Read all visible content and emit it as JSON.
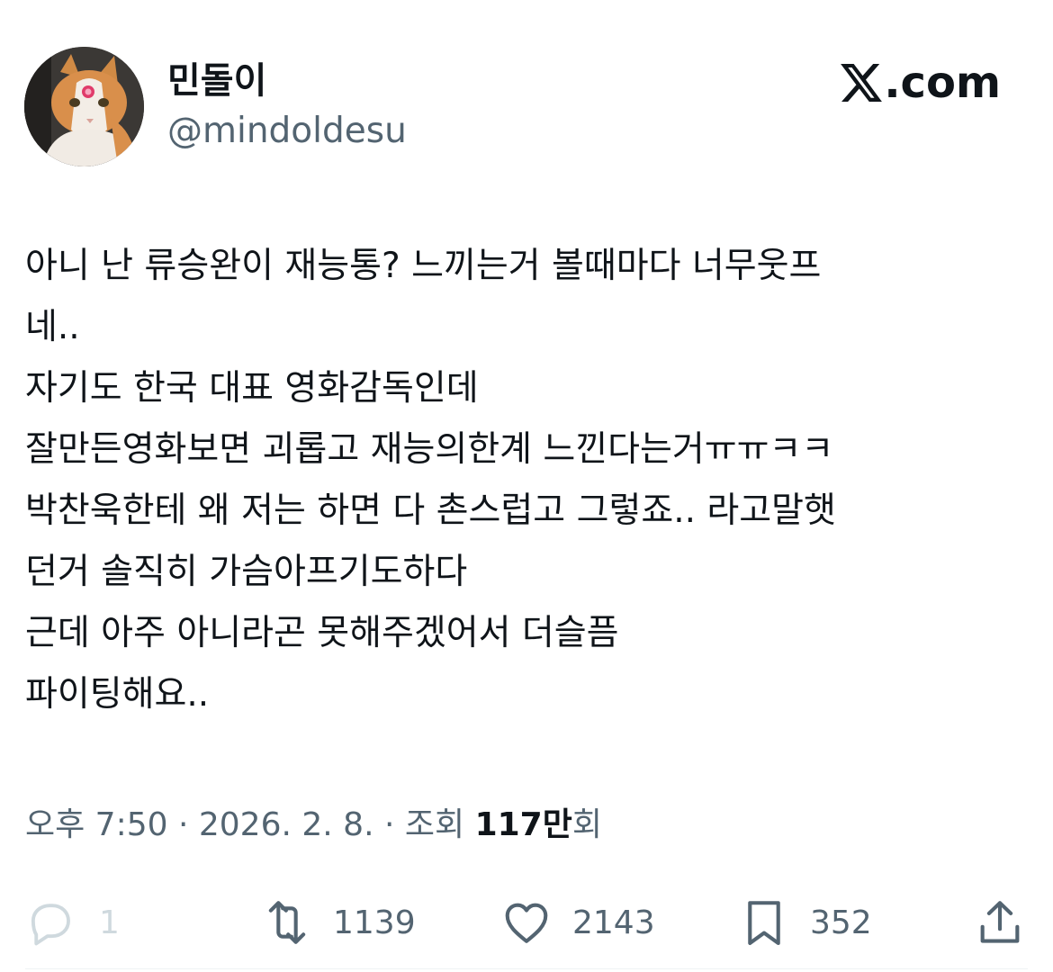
{
  "author": {
    "display_name": "민돌이",
    "handle": "@mindoldesu"
  },
  "brand": {
    "logo_icon": "x-logo-icon",
    "label": ".com"
  },
  "tweet": {
    "lines": [
      "아니 난 류승완이 재능통? 느끼는거 볼때마다 너무웃프",
      "네..",
      "자기도 한국 대표 영화감독인데",
      "잘만든영화보면 괴롭고 재능의한계 느낀다는거ㅠㅠㅋㅋ",
      "박찬욱한테 왜 저는 하면 다 촌스럽고 그렇죠.. 라고말햇",
      "던거 솔직히 가슴아프기도하다",
      "근데 아주 아니라곤 못해주겠어서 더슬픔",
      "파이팅해요.."
    ]
  },
  "meta": {
    "time": "오후 7:50",
    "separator": " · ",
    "date": "2026. 2. 8.",
    "views_prefix": "조회 ",
    "views_count": "117만",
    "views_suffix": "회"
  },
  "actions": [
    {
      "icon": "reply-icon",
      "count": "1"
    },
    {
      "icon": "retweet-icon",
      "count": "1139"
    },
    {
      "icon": "heart-icon",
      "count": "2143"
    },
    {
      "icon": "bookmark-icon",
      "count": "352"
    },
    {
      "icon": "share-icon",
      "count": ""
    }
  ],
  "colors": {
    "text": "#0f1419",
    "secondary": "#536471",
    "reply_muted": "#cfd9de"
  }
}
